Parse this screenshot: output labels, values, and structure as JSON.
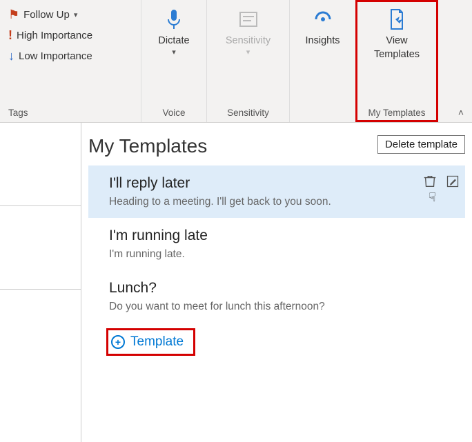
{
  "ribbon": {
    "tags": {
      "follow_up": "Follow Up",
      "high": "High Importance",
      "low": "Low Importance",
      "group_label": "Tags"
    },
    "voice": {
      "label": "Dictate",
      "group_label": "Voice"
    },
    "sensitivity": {
      "label": "Sensitivity",
      "group_label": "Sensitivity"
    },
    "insights": {
      "label": "Insights"
    },
    "templates": {
      "label_l1": "View",
      "label_l2": "Templates",
      "group_label": "My Templates"
    }
  },
  "pane": {
    "title": "My Templates",
    "delete_label": "Delete template",
    "items": [
      {
        "title": "I'll reply later",
        "body": "Heading to a meeting. I'll get back to you soon."
      },
      {
        "title": "I'm running late",
        "body": "I'm running late."
      },
      {
        "title": "Lunch?",
        "body": "Do you want to meet for lunch this afternoon?"
      }
    ],
    "add_label": "Template"
  }
}
